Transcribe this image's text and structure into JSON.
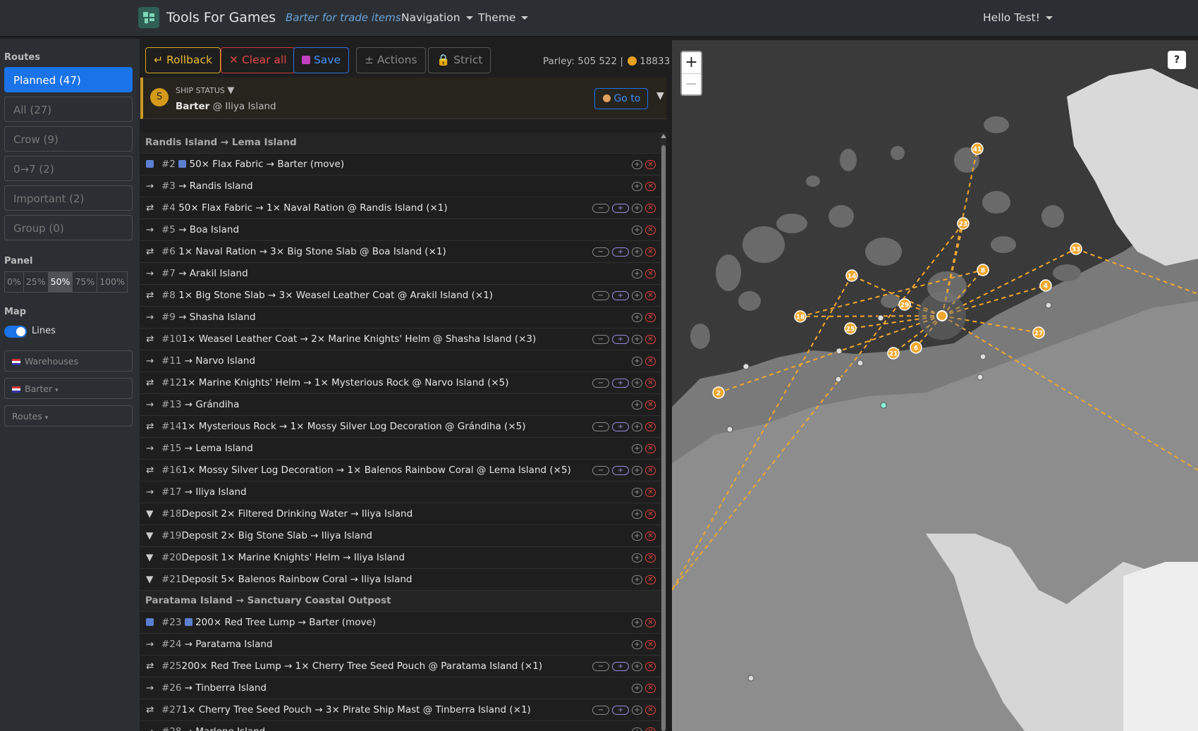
{
  "navbar": {
    "brand": "Tools For Games",
    "subtitle": "Barter for trade items",
    "navigation": "Navigation",
    "theme": "Theme",
    "user": "Hello Test!"
  },
  "sidebar": {
    "routes_label": "Routes",
    "routes": [
      "Planned (47)",
      "All (27)",
      "Crow (9)",
      "0→7 (2)",
      "Important (2)",
      "Group (0)"
    ],
    "panel_label": "Panel",
    "panel_options": [
      "0%",
      "25%",
      "50%",
      "75%",
      "100%"
    ],
    "panel_selected": "50%",
    "map_label": "Map",
    "lines_label": "Lines",
    "warehouses": "Warehouses",
    "barter": "Barter",
    "routes_select": "Routes"
  },
  "toolbar": {
    "rollback": "Rollback",
    "clear_all": "Clear all",
    "save": "Save",
    "actions": "± Actions",
    "strict": "Strict",
    "parley": "Parley: 505 522",
    "coins": "18833"
  },
  "ship_status": {
    "label": "SHIP STATUS",
    "avatar": "S",
    "mode": "Barter",
    "location": "@ Iliya Island",
    "goto": "Go to"
  },
  "groups": [
    {
      "title": "Randis Island → Lema Island",
      "rows": [
        {
          "icon": "ship",
          "num": "#2",
          "text": "50× Flax Fabric → Barter (move)",
          "type": "move"
        },
        {
          "icon": "→",
          "num": "#3",
          "text": "→ Randis Island",
          "type": "sail"
        },
        {
          "icon": "⇄",
          "num": "#4",
          "text": "50× Flax Fabric → 1× Naval Ration @ Randis Island (×1)",
          "type": "trade"
        },
        {
          "icon": "→",
          "num": "#5",
          "text": "→ Boa Island",
          "type": "sail"
        },
        {
          "icon": "⇄",
          "num": "#6",
          "text": "1× Naval Ration → 3× Big Stone Slab @ Boa Island (×1)",
          "type": "trade"
        },
        {
          "icon": "→",
          "num": "#7",
          "text": "→ Arakil Island",
          "type": "sail"
        },
        {
          "icon": "⇄",
          "num": "#8",
          "text": "1× Big Stone Slab → 3× Weasel Leather Coat @ Arakil Island (×1)",
          "type": "trade"
        },
        {
          "icon": "→",
          "num": "#9",
          "text": "→ Shasha Island",
          "type": "sail"
        },
        {
          "icon": "⇄",
          "num": "#10",
          "text": "1× Weasel Leather Coat → 2× Marine Knights' Helm @ Shasha Island (×3)",
          "type": "trade"
        },
        {
          "icon": "→",
          "num": "#11",
          "text": "→ Narvo Island",
          "type": "sail"
        },
        {
          "icon": "⇄",
          "num": "#12",
          "text": "1× Marine Knights' Helm → 1× Mysterious Rock @ Narvo Island (×5)",
          "type": "trade"
        },
        {
          "icon": "→",
          "num": "#13",
          "text": "→ Grándiha",
          "type": "sail"
        },
        {
          "icon": "⇄",
          "num": "#14",
          "text": "1× Mysterious Rock → 1× Mossy Silver Log Decoration @ Grándiha (×5)",
          "type": "trade"
        },
        {
          "icon": "→",
          "num": "#15",
          "text": "→ Lema Island",
          "type": "sail"
        },
        {
          "icon": "⇄",
          "num": "#16",
          "text": "1× Mossy Silver Log Decoration → 1× Balenos Rainbow Coral @ Lema Island (×5)",
          "type": "trade"
        },
        {
          "icon": "→",
          "num": "#17",
          "text": "→ Iliya Island",
          "type": "sail"
        },
        {
          "icon": "▼",
          "num": "#18",
          "text": "Deposit 2× Filtered Drinking Water → Iliya Island",
          "type": "deposit"
        },
        {
          "icon": "▼",
          "num": "#19",
          "text": "Deposit 2× Big Stone Slab → Iliya Island",
          "type": "deposit"
        },
        {
          "icon": "▼",
          "num": "#20",
          "text": "Deposit 1× Marine Knights' Helm → Iliya Island",
          "type": "deposit"
        },
        {
          "icon": "▼",
          "num": "#21",
          "text": "Deposit 5× Balenos Rainbow Coral → Iliya Island",
          "type": "deposit"
        }
      ]
    },
    {
      "title": "Paratama Island → Sanctuary Coastal Outpost",
      "rows": [
        {
          "icon": "ship",
          "num": "#23",
          "text": "200× Red Tree Lump → Barter (move)",
          "type": "move"
        },
        {
          "icon": "→",
          "num": "#24",
          "text": "→ Paratama Island",
          "type": "sail"
        },
        {
          "icon": "⇄",
          "num": "#25",
          "text": "200× Red Tree Lump → 1× Cherry Tree Seed Pouch @ Paratama Island (×1)",
          "type": "trade"
        },
        {
          "icon": "→",
          "num": "#26",
          "text": "→ Tinberra Island",
          "type": "sail"
        },
        {
          "icon": "⇄",
          "num": "#27",
          "text": "1× Cherry Tree Seed Pouch → 3× Pirate Ship Mast @ Tinberra Island (×1)",
          "type": "trade"
        },
        {
          "icon": "→",
          "num": "#28",
          "text": "→ Marlene Island",
          "type": "sail"
        }
      ]
    }
  ],
  "map": {
    "zoom_in": "+",
    "zoom_out": "−",
    "help": "?",
    "markers": [
      "41",
      "23",
      "33",
      "14",
      "8",
      "4",
      "18",
      "29",
      "25",
      "27",
      "6",
      "21",
      "2"
    ]
  }
}
